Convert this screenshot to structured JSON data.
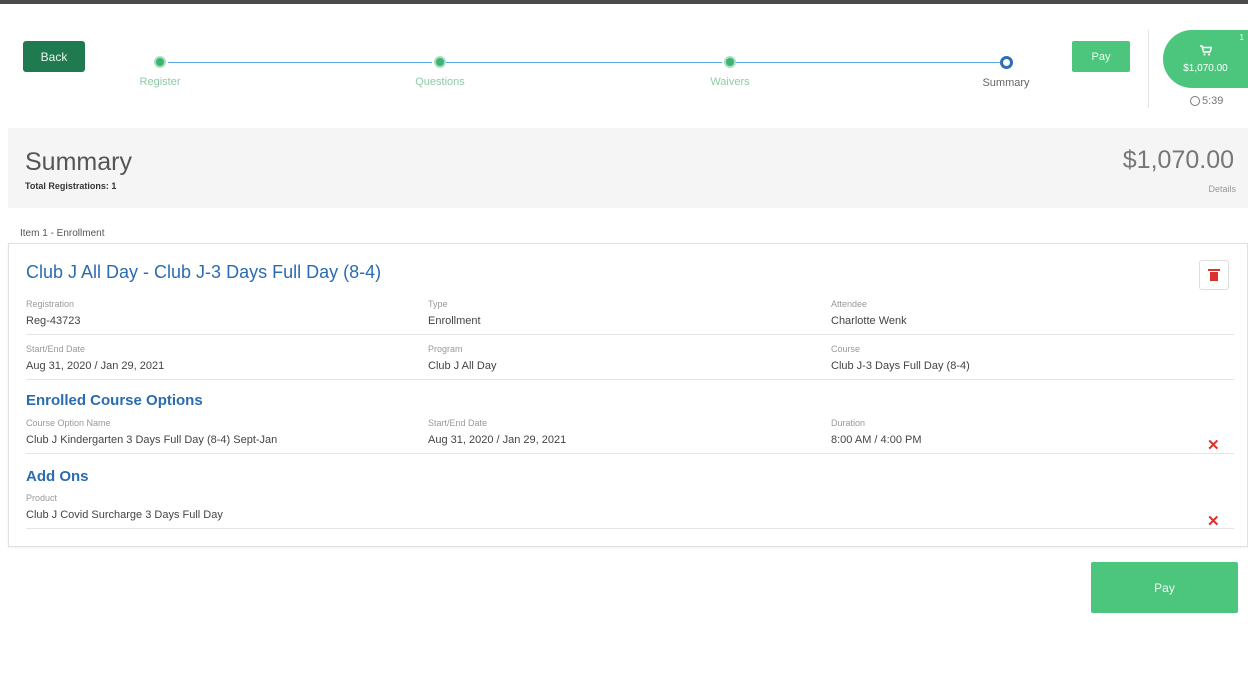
{
  "nav": {
    "back_label": "Back",
    "pay_label": "Pay"
  },
  "stepper": {
    "steps": [
      {
        "label": "Register",
        "state": "done"
      },
      {
        "label": "Questions",
        "state": "done"
      },
      {
        "label": "Waivers",
        "state": "done"
      },
      {
        "label": "Summary",
        "state": "current"
      }
    ]
  },
  "cart": {
    "icon": "cart-icon",
    "total": "$1,070.00",
    "badge": "1",
    "timer": "5:39"
  },
  "summary": {
    "title": "Summary",
    "total_registrations": "Total Registrations: 1",
    "amount": "$1,070.00",
    "details_label": "Details"
  },
  "item": {
    "label": "Item 1 - Enrollment",
    "title": "Club J All Day - Club J-3 Days Full Day (8-4)",
    "fields": {
      "registration": {
        "label": "Registration",
        "value": "Reg-43723"
      },
      "type": {
        "label": "Type",
        "value": "Enrollment"
      },
      "attendee": {
        "label": "Attendee",
        "value": "Charlotte Wenk"
      },
      "start_end": {
        "label": "Start/End Date",
        "value": "Aug 31, 2020 / Jan 29, 2021"
      },
      "program": {
        "label": "Program",
        "value": "Club J All Day"
      },
      "course": {
        "label": "Course",
        "value": "Club J-3 Days Full Day (8-4)"
      }
    },
    "course_options": {
      "heading": "Enrolled Course Options",
      "name_label": "Course Option Name",
      "name_value": "Club J Kindergarten 3 Days Full Day (8-4) Sept-Jan",
      "date_label": "Start/End Date",
      "date_value": "Aug 31, 2020 / Jan 29, 2021",
      "duration_label": "Duration",
      "duration_value": "8:00 AM / 4:00 PM"
    },
    "add_ons": {
      "heading": "Add Ons",
      "product_label": "Product",
      "product_value": "Club J Covid Surcharge 3 Days Full Day"
    }
  },
  "footer": {
    "pay_label": "Pay"
  },
  "colors": {
    "green": "#4dc67d",
    "dark_green": "#1f7a4f",
    "blue": "#2b6cb0",
    "red": "#d9342b"
  }
}
